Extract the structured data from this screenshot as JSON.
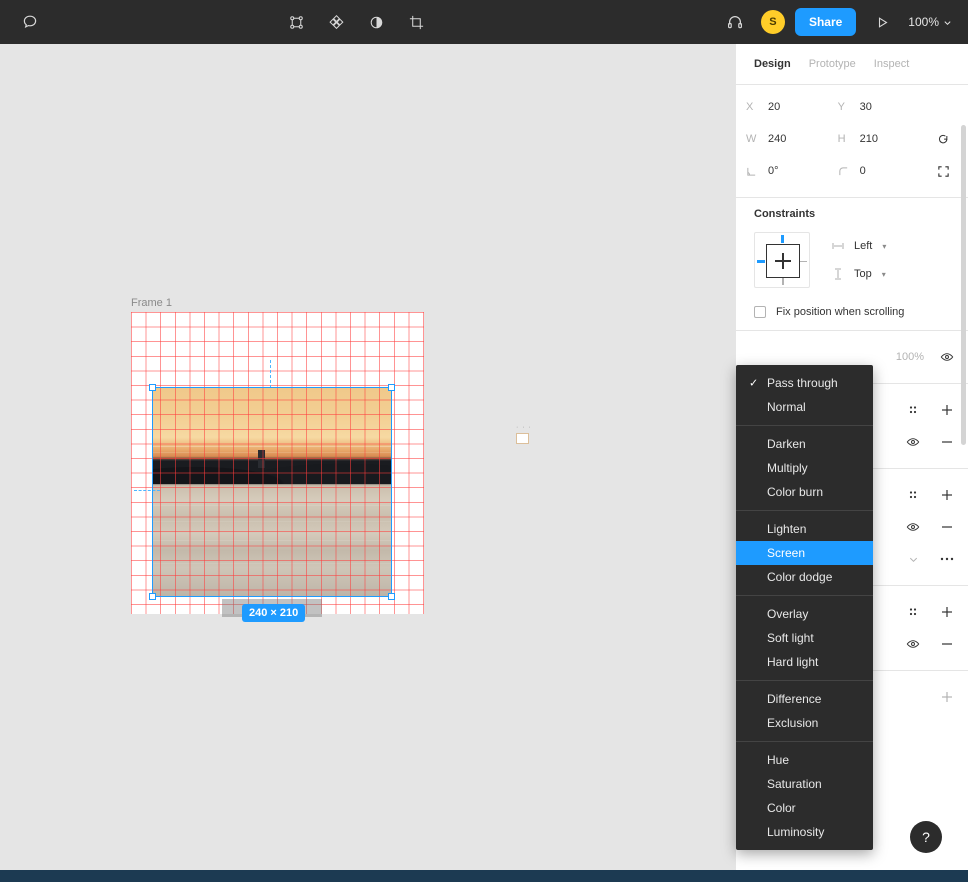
{
  "toolbar": {
    "comment_icon": "comment-bubble-icon",
    "tools": [
      {
        "name": "frame-tool-icon",
        "label": "Frame"
      },
      {
        "name": "component-tool-icon",
        "label": "Component"
      },
      {
        "name": "mask-tool-icon",
        "label": "Mask"
      },
      {
        "name": "crop-tool-icon",
        "label": "Crop"
      }
    ],
    "headphones_icon": "headphones-icon",
    "avatar_initial": "S",
    "share_label": "Share",
    "present_icon": "play-icon",
    "zoom_level": "100%"
  },
  "canvas": {
    "frame_label": "Frame 1",
    "size_badge": "240 × 210"
  },
  "panel": {
    "tabs": [
      {
        "label": "Design",
        "active": true
      },
      {
        "label": "Prototype",
        "active": false
      },
      {
        "label": "Inspect",
        "active": false
      }
    ],
    "properties": [
      {
        "label": "X",
        "value": "20",
        "label2": "Y",
        "value2": "30",
        "action": ""
      },
      {
        "label": "W",
        "value": "240",
        "label2": "H",
        "value2": "210",
        "action": "rotate-icon"
      },
      {
        "label": "angle-icon",
        "value": "0°",
        "label2": "corner-radius-icon",
        "value2": "0",
        "action": "expand-icon"
      }
    ],
    "constraints": {
      "title": "Constraints",
      "horizontal": "Left",
      "vertical": "Top",
      "fix_position_label": "Fix position when scrolling",
      "fix_position_checked": false
    },
    "layer": {
      "opacity": "100%"
    }
  },
  "blend_menu": {
    "groups": [
      [
        {
          "label": "Pass through",
          "checked": true,
          "selected": false
        },
        {
          "label": "Normal",
          "checked": false,
          "selected": false
        }
      ],
      [
        {
          "label": "Darken",
          "checked": false,
          "selected": false
        },
        {
          "label": "Multiply",
          "checked": false,
          "selected": false
        },
        {
          "label": "Color burn",
          "checked": false,
          "selected": false
        }
      ],
      [
        {
          "label": "Lighten",
          "checked": false,
          "selected": false
        },
        {
          "label": "Screen",
          "checked": false,
          "selected": true
        },
        {
          "label": "Color dodge",
          "checked": false,
          "selected": false
        }
      ],
      [
        {
          "label": "Overlay",
          "checked": false,
          "selected": false
        },
        {
          "label": "Soft light",
          "checked": false,
          "selected": false
        },
        {
          "label": "Hard light",
          "checked": false,
          "selected": false
        }
      ],
      [
        {
          "label": "Difference",
          "checked": false,
          "selected": false
        },
        {
          "label": "Exclusion",
          "checked": false,
          "selected": false
        }
      ],
      [
        {
          "label": "Hue",
          "checked": false,
          "selected": false
        },
        {
          "label": "Saturation",
          "checked": false,
          "selected": false
        },
        {
          "label": "Color",
          "checked": false,
          "selected": false
        },
        {
          "label": "Luminosity",
          "checked": false,
          "selected": false
        }
      ]
    ]
  },
  "help": {
    "label": "?"
  },
  "colors": {
    "accent": "#1e9bff",
    "toolbar_bg": "#2c2c2c",
    "canvas_bg": "#e5e5e5",
    "grid": "#ff3c3c",
    "avatar": "#ffcd29",
    "footer": "#1c3a52"
  }
}
